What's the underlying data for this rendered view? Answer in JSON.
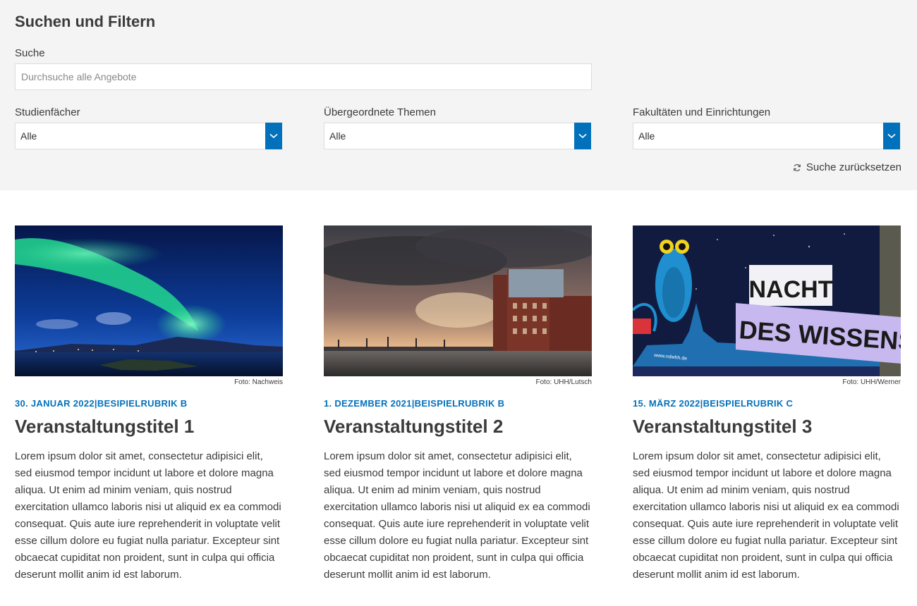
{
  "filter": {
    "title": "Suchen und Filtern",
    "search_label": "Suche",
    "search_placeholder": "Durchsuche alle Angebote",
    "search_value": "",
    "selects": [
      {
        "label": "Studienfächer",
        "value": "Alle"
      },
      {
        "label": "Übergeordnete Themen",
        "value": "Alle"
      },
      {
        "label": "Fakultäten und Einrichtungen",
        "value": "Alle"
      }
    ],
    "reset_label": "Suche zurücksetzen"
  },
  "colors": {
    "accent": "#0271bb",
    "panel_bg": "#f4f4f4",
    "text": "#3b3b3b"
  },
  "cards": [
    {
      "image_alt": "Nordlichter über einer Küste",
      "credit": "Foto: Nachweis",
      "meta": "30. Januar 2022|Besipielrubrik B",
      "title": "Veranstaltungstitel 1",
      "text": "Lorem ipsum dolor sit amet, consectetur adipisici elit, sed eiusmod tempor incidunt ut labore et dolore magna aliqua. Ut enim ad minim veniam, quis nostrud exercitation ullamco laboris nisi ut aliquid ex ea commodi consequat. Quis aute iure reprehenderit in voluptate velit esse cillum dolore eu fugiat nulla pariatur. Excepteur sint obcaecat cupiditat non proident, sunt in culpa qui officia deserunt mollit anim id est laborum."
    },
    {
      "image_alt": "Hafen mit Backsteingebäude bei Sonnenuntergang",
      "credit": "Foto: UHH/Lutsch",
      "meta": "1. Dezember 2021|Beispielrubrik B",
      "title": "Veranstaltungstitel 2",
      "text": "Lorem ipsum dolor sit amet, consectetur adipisici elit, sed eiusmod tempor incidunt ut labore et dolore magna aliqua. Ut enim ad minim veniam, quis nostrud exercitation ullamco laboris nisi ut aliquid ex ea commodi consequat. Quis aute iure reprehenderit in voluptate velit esse cillum dolore eu fugiat nulla pariatur. Excepteur sint obcaecat cupiditat non proident, sunt in culpa qui officia deserunt mollit anim id est laborum."
    },
    {
      "image_alt": "Banner Nacht des Wissens mit Eule",
      "credit": "Foto: UHH/Werner",
      "meta": "15. März 2022|Beispielrubrik C",
      "title": "Veranstaltungstitel 3",
      "text": "Lorem ipsum dolor sit amet, consectetur adipisici elit, sed eiusmod tempor incidunt ut labore et dolore magna aliqua. Ut enim ad minim veniam, quis nostrud exercitation ullamco laboris nisi ut aliquid ex ea commodi consequat. Quis aute iure reprehenderit in voluptate velit esse cillum dolore eu fugiat nulla pariatur. Excepteur sint obcaecat cupiditat non proident, sunt in culpa qui officia deserunt mollit anim id est laborum.",
      "banner_line1": "NACHT",
      "banner_line2": "DES WISSENS",
      "banner_url": "www.ndwhh.de"
    }
  ]
}
